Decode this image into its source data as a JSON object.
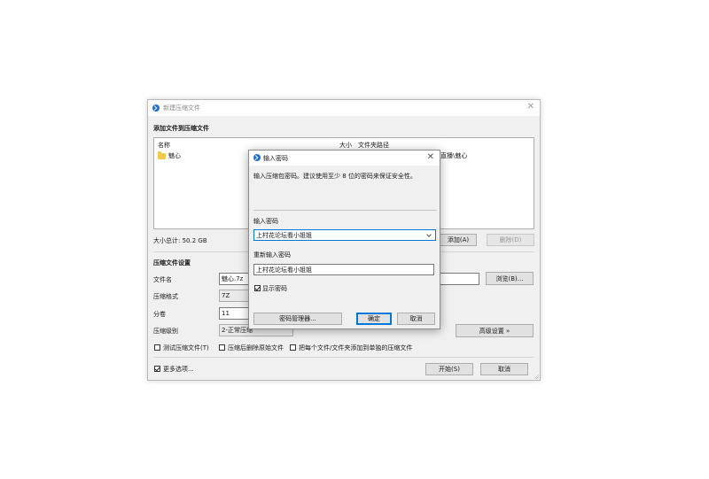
{
  "main_window": {
    "title": "新建压缩文件",
    "section_add": "添加文件到压缩文件",
    "col_name": "名称",
    "col_size": "大小",
    "col_path": "文件夹路径",
    "file_item_name": "魅心",
    "file_item_path_partial": "直播\\魅心",
    "total_size": "大小总计: 50.2 GB",
    "add_button": "添加(A)",
    "delete_button": "删除(D)",
    "section_settings": "压缩文件设置",
    "filename_label": "文件名",
    "filename_value": "魅心.7z",
    "browse_button": "浏览(B)...",
    "format_label": "压缩格式",
    "format_value": "7Z",
    "split_label": "分卷",
    "split_value": "11",
    "level_label": "压缩级别",
    "level_value": "2-正常压缩",
    "advanced_button": "高级设置 »",
    "test_label": "测试压缩文件(T)",
    "delete_after_label": "压缩后删除原始文件",
    "each_separate_label": "把每个文件/文件夹添加到单独的压缩文件",
    "more_options_label": "更多选项...",
    "start_button": "开始(S)",
    "cancel_button": "取消"
  },
  "password_dialog": {
    "title": "输入密码",
    "hint": "输入压缩包密码。建议使用至少 8 位的密码来保证安全性。",
    "enter_label": "输入密码",
    "password_value": "上村花论坛看小姐姐",
    "reenter_label": "重新输入密码",
    "reenter_value": "上村花论坛看小姐姐",
    "show_password_label": "显示密码",
    "show_password_checked": true,
    "manager_button": "密码管理器...",
    "ok_button": "确定",
    "cancel_button": "取消"
  },
  "colors": {
    "accent": "#0078d7",
    "app_icon": "#1f6fd0",
    "folder": "#f3c94b"
  }
}
